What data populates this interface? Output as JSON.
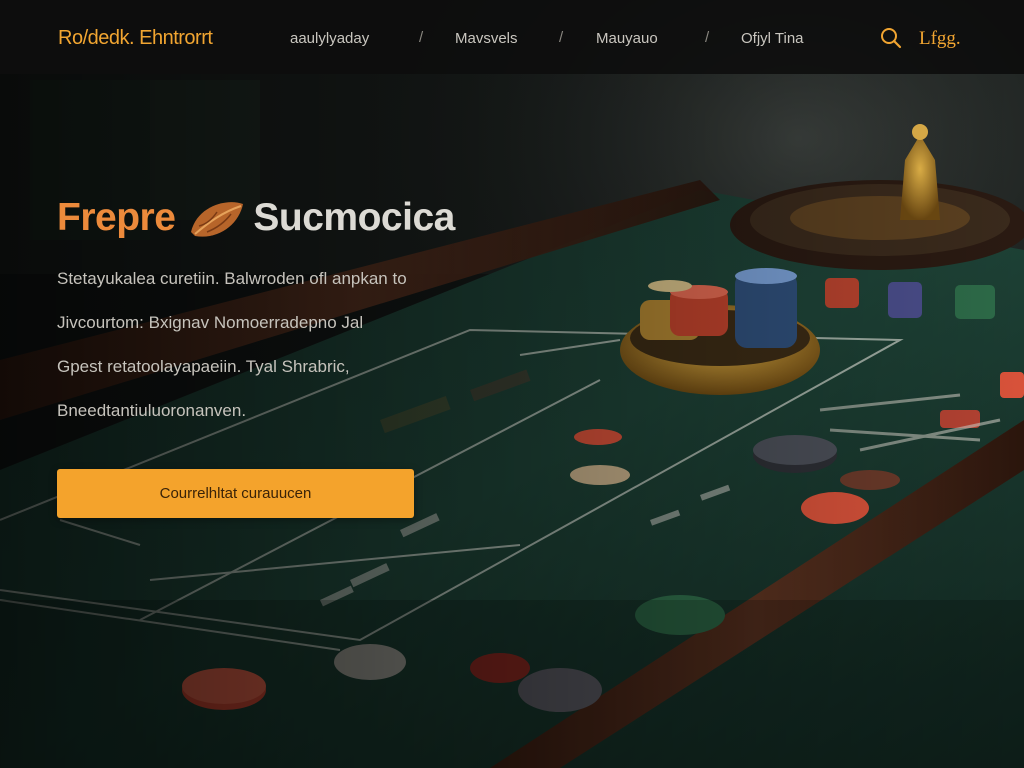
{
  "brand": {
    "name": "Ro/dedk. Ehntrorrt"
  },
  "nav": {
    "items": [
      {
        "label": "aaulylyaday"
      },
      {
        "label": "Mavsvels"
      },
      {
        "label": "Mauyauo"
      },
      {
        "label": "Ofjyl Tina"
      }
    ],
    "separator": "/",
    "language": "Lfgg."
  },
  "hero": {
    "title_accent": "Frepre",
    "title_rest": "Sucmocica",
    "lines": [
      "Stetayukalea curetiin. Balwroden ofl anpkan to",
      "Jivcourtom: Bxignav Nomoerradepno Jal",
      "Gpest retatoolayapaeiin. Tyal Shrabric,",
      "Bneedtantiuluoronanven."
    ],
    "cta_label": "Courrelhltat curauucen"
  },
  "colors": {
    "accent": "#f4a32c",
    "title_accent": "#ec8a3b",
    "felt": "#1f3a32",
    "nav_bg": "#0c0d0c"
  }
}
